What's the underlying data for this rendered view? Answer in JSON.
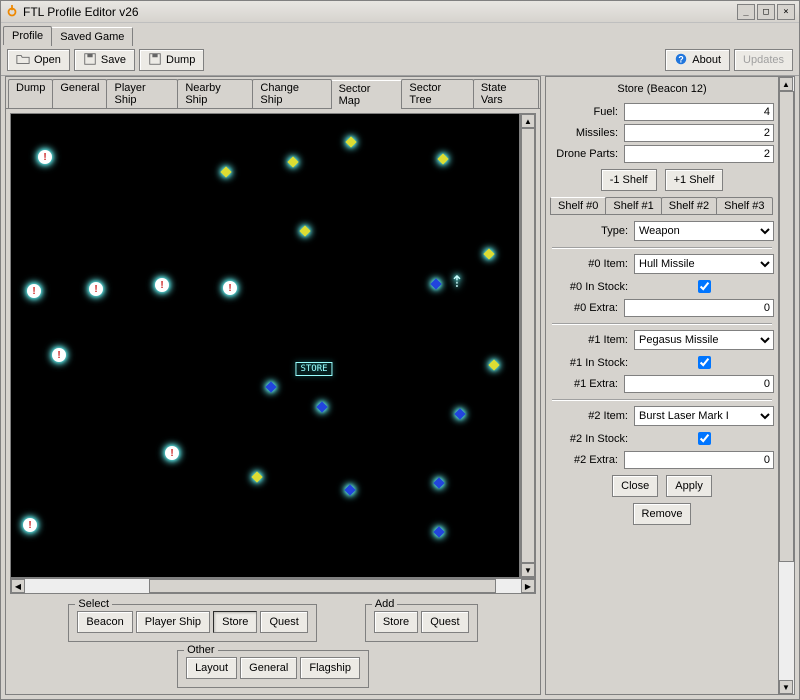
{
  "window": {
    "title": "FTL Profile Editor v26"
  },
  "top_tabs": {
    "profile": "Profile",
    "saved_game": "Saved Game"
  },
  "toolbar": {
    "open": "Open",
    "save": "Save",
    "dump": "Dump",
    "about": "About",
    "updates": "Updates"
  },
  "subtabs": [
    "Dump",
    "General",
    "Player Ship",
    "Nearby Ship",
    "Change Ship",
    "Sector Map",
    "Sector Tree",
    "State Vars"
  ],
  "subtabs_active": 5,
  "map": {
    "store_label": "STORE"
  },
  "select_group": {
    "legend": "Select",
    "beacon": "Beacon",
    "player_ship": "Player Ship",
    "store": "Store",
    "quest": "Quest"
  },
  "add_group": {
    "legend": "Add",
    "store": "Store",
    "quest": "Quest"
  },
  "other_group": {
    "legend": "Other",
    "layout": "Layout",
    "general": "General",
    "flagship": "Flagship"
  },
  "store": {
    "title": "Store (Beacon 12)",
    "fuel_label": "Fuel:",
    "fuel_value": "4",
    "missiles_label": "Missiles:",
    "missiles_value": "2",
    "drone_label": "Drone Parts:",
    "drone_value": "2",
    "minus_shelf": "-1 Shelf",
    "plus_shelf": "+1 Shelf",
    "shelves": [
      "Shelf #0",
      "Shelf #1",
      "Shelf #2",
      "Shelf #3"
    ],
    "type_label": "Type:",
    "type_value": "Weapon",
    "items": [
      {
        "item_label": "#0 Item:",
        "item_value": "Hull Missile",
        "stock_label": "#0 In Stock:",
        "stock": true,
        "extra_label": "#0 Extra:",
        "extra_value": "0"
      },
      {
        "item_label": "#1 Item:",
        "item_value": "Pegasus Missile",
        "stock_label": "#1 In Stock:",
        "stock": true,
        "extra_label": "#1 Extra:",
        "extra_value": "0"
      },
      {
        "item_label": "#2 Item:",
        "item_value": "Burst Laser Mark I",
        "stock_label": "#2 In Stock:",
        "stock": true,
        "extra_label": "#2 Extra:",
        "extra_value": "0"
      }
    ],
    "close": "Close",
    "apply": "Apply",
    "remove": "Remove"
  }
}
